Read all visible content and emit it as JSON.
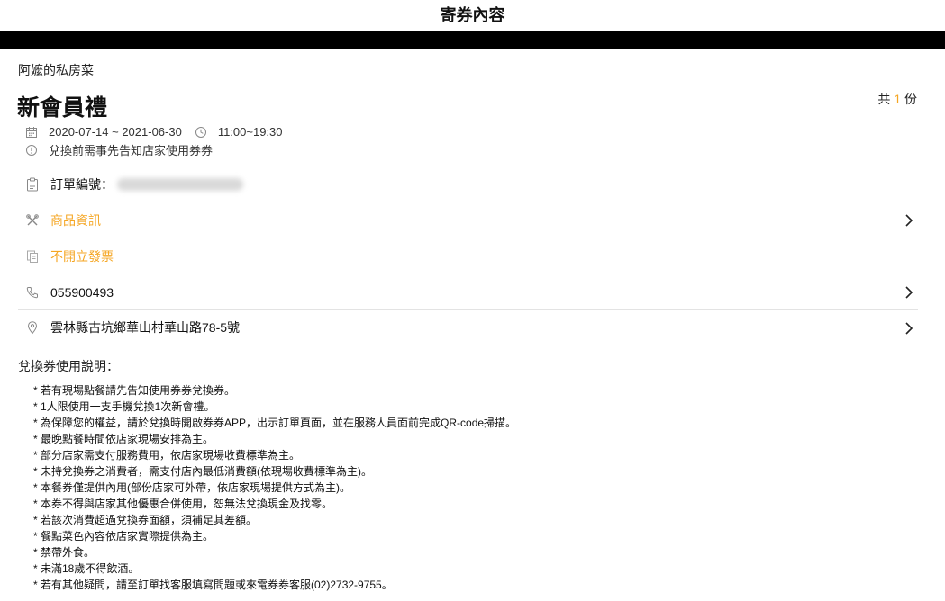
{
  "header": {
    "title": "寄券內容"
  },
  "voucher": {
    "store_name": "阿嬤的私房菜",
    "product_name": "新會員禮",
    "quantity_prefix": "共",
    "quantity": "1",
    "quantity_suffix": "份",
    "date_range": "2020-07-14 ~ 2021-06-30",
    "time_range": "11:00~19:30",
    "notice": "兌換前需事先告知店家使用券券"
  },
  "rows": {
    "order_label": "訂單編號：",
    "product_info": "商品資訊",
    "invoice": "不開立發票",
    "phone": "055900493",
    "address": "雲林縣古坑鄉華山村華山路78-5號"
  },
  "instructions": {
    "title": "兌換券使用說明：",
    "items": [
      "* 若有現場點餐請先告知使用券券兌換券。",
      "* 1人限使用一支手機兌換1次新會禮。",
      "* 為保障您的權益，請於兌換時開啟券券APP，出示訂單頁面，並在服務人員面前完成QR-code掃描。",
      "* 最晚點餐時間依店家現場安排為主。",
      "* 部分店家需支付服務費用，依店家現場收費標準為主。",
      "* 未持兌換券之消費者，需支付店內最低消費額(依現場收費標準為主)。",
      "* 本餐券僅提供內用(部份店家可外帶，依店家現場提供方式為主)。",
      "* 本券不得與店家其他優惠合併使用，恕無法兌換現金及找零。",
      "* 若該次消費超過兌換券面額，須補足其差額。",
      "* 餐點菜色內容依店家實際提供為主。",
      "* 禁帶外食。",
      "* 未滿18歲不得飲酒。",
      "* 若有其他疑問，請至訂單找客服填寫問題或來電券券客服(02)2732-9755。"
    ]
  },
  "colors": {
    "accent": "#f5a623",
    "divider": "#e3e3e3",
    "header_bar": "#000000"
  }
}
